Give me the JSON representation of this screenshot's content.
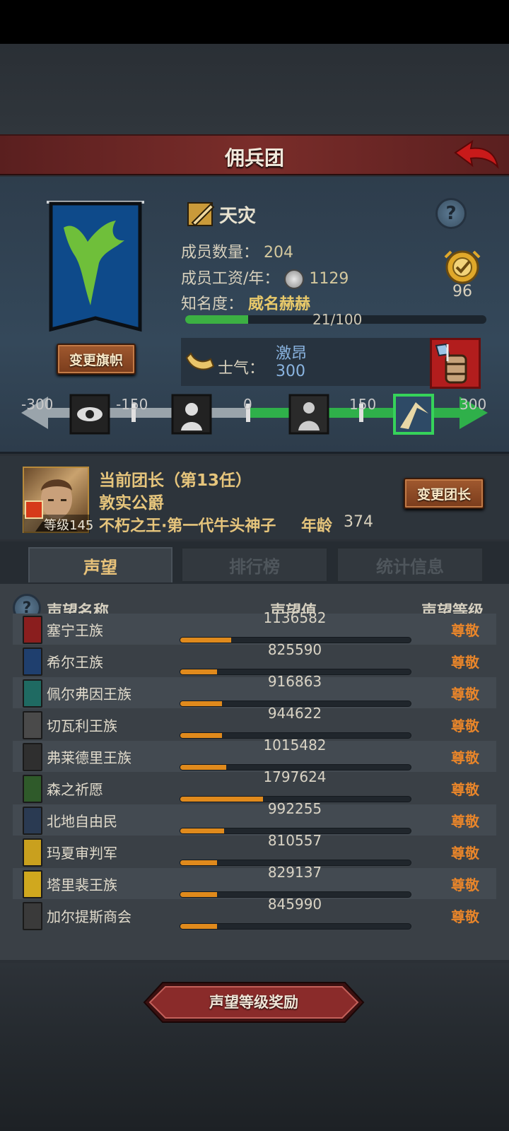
{
  "header": {
    "title": "佣兵团"
  },
  "guild": {
    "name": "天灾",
    "member_count_label": "成员数量：",
    "member_count": "204",
    "salary_label": "成员工资/年：",
    "salary": "1129",
    "fame_label": "知名度：",
    "fame_title": "威名赫赫",
    "fame_progress_text": "21/100",
    "fame_progress": 0.21,
    "award_count": "96",
    "change_banner_label": "变更旗帜"
  },
  "morale": {
    "label": "士气：",
    "state": "激昂",
    "value": "300",
    "scale_ticks": [
      "-300",
      "-150",
      "0",
      "150",
      "300"
    ]
  },
  "leader": {
    "title": "当前团长（第13任）",
    "rank": "敦实公爵",
    "level": "等级145",
    "name": "不朽之王·第一代牛头神子",
    "age_label": "年龄",
    "age": "374",
    "change_leader_label": "变更团长"
  },
  "tabs": [
    {
      "label": "声望",
      "active": true
    },
    {
      "label": "排行榜",
      "active": false
    },
    {
      "label": "统计信息",
      "active": false
    }
  ],
  "reputation": {
    "col_name": "声望名称",
    "col_value": "声望值",
    "col_level": "声望等级",
    "rows": [
      {
        "name": "塞宁王族",
        "value": "1136582",
        "fill": 0.22,
        "level": "尊敬",
        "color": "#8a1e1e"
      },
      {
        "name": "希尔王族",
        "value": "825590",
        "fill": 0.16,
        "level": "尊敬",
        "color": "#1f3f6e"
      },
      {
        "name": "佩尔弗因王族",
        "value": "916863",
        "fill": 0.18,
        "level": "尊敬",
        "color": "#1f6a62"
      },
      {
        "name": "切瓦利王族",
        "value": "944622",
        "fill": 0.18,
        "level": "尊敬",
        "color": "#4a4a4a"
      },
      {
        "name": "弗莱德里王族",
        "value": "1015482",
        "fill": 0.2,
        "level": "尊敬",
        "color": "#2f2f2f"
      },
      {
        "name": "森之祈愿",
        "value": "1797624",
        "fill": 0.36,
        "level": "尊敬",
        "color": "#2f5a2a"
      },
      {
        "name": "北地自由民",
        "value": "992255",
        "fill": 0.19,
        "level": "尊敬",
        "color": "#2a3a52"
      },
      {
        "name": "玛夏审判军",
        "value": "810557",
        "fill": 0.16,
        "level": "尊敬",
        "color": "#c9a01e"
      },
      {
        "name": "塔里裴王族",
        "value": "829137",
        "fill": 0.16,
        "level": "尊敬",
        "color": "#d0a81e"
      },
      {
        "name": "加尔提斯商会",
        "value": "845990",
        "fill": 0.16,
        "level": "尊敬",
        "color": "#3a3a3a"
      }
    ]
  },
  "footer": {
    "reward_button_label": "声望等级奖励"
  }
}
